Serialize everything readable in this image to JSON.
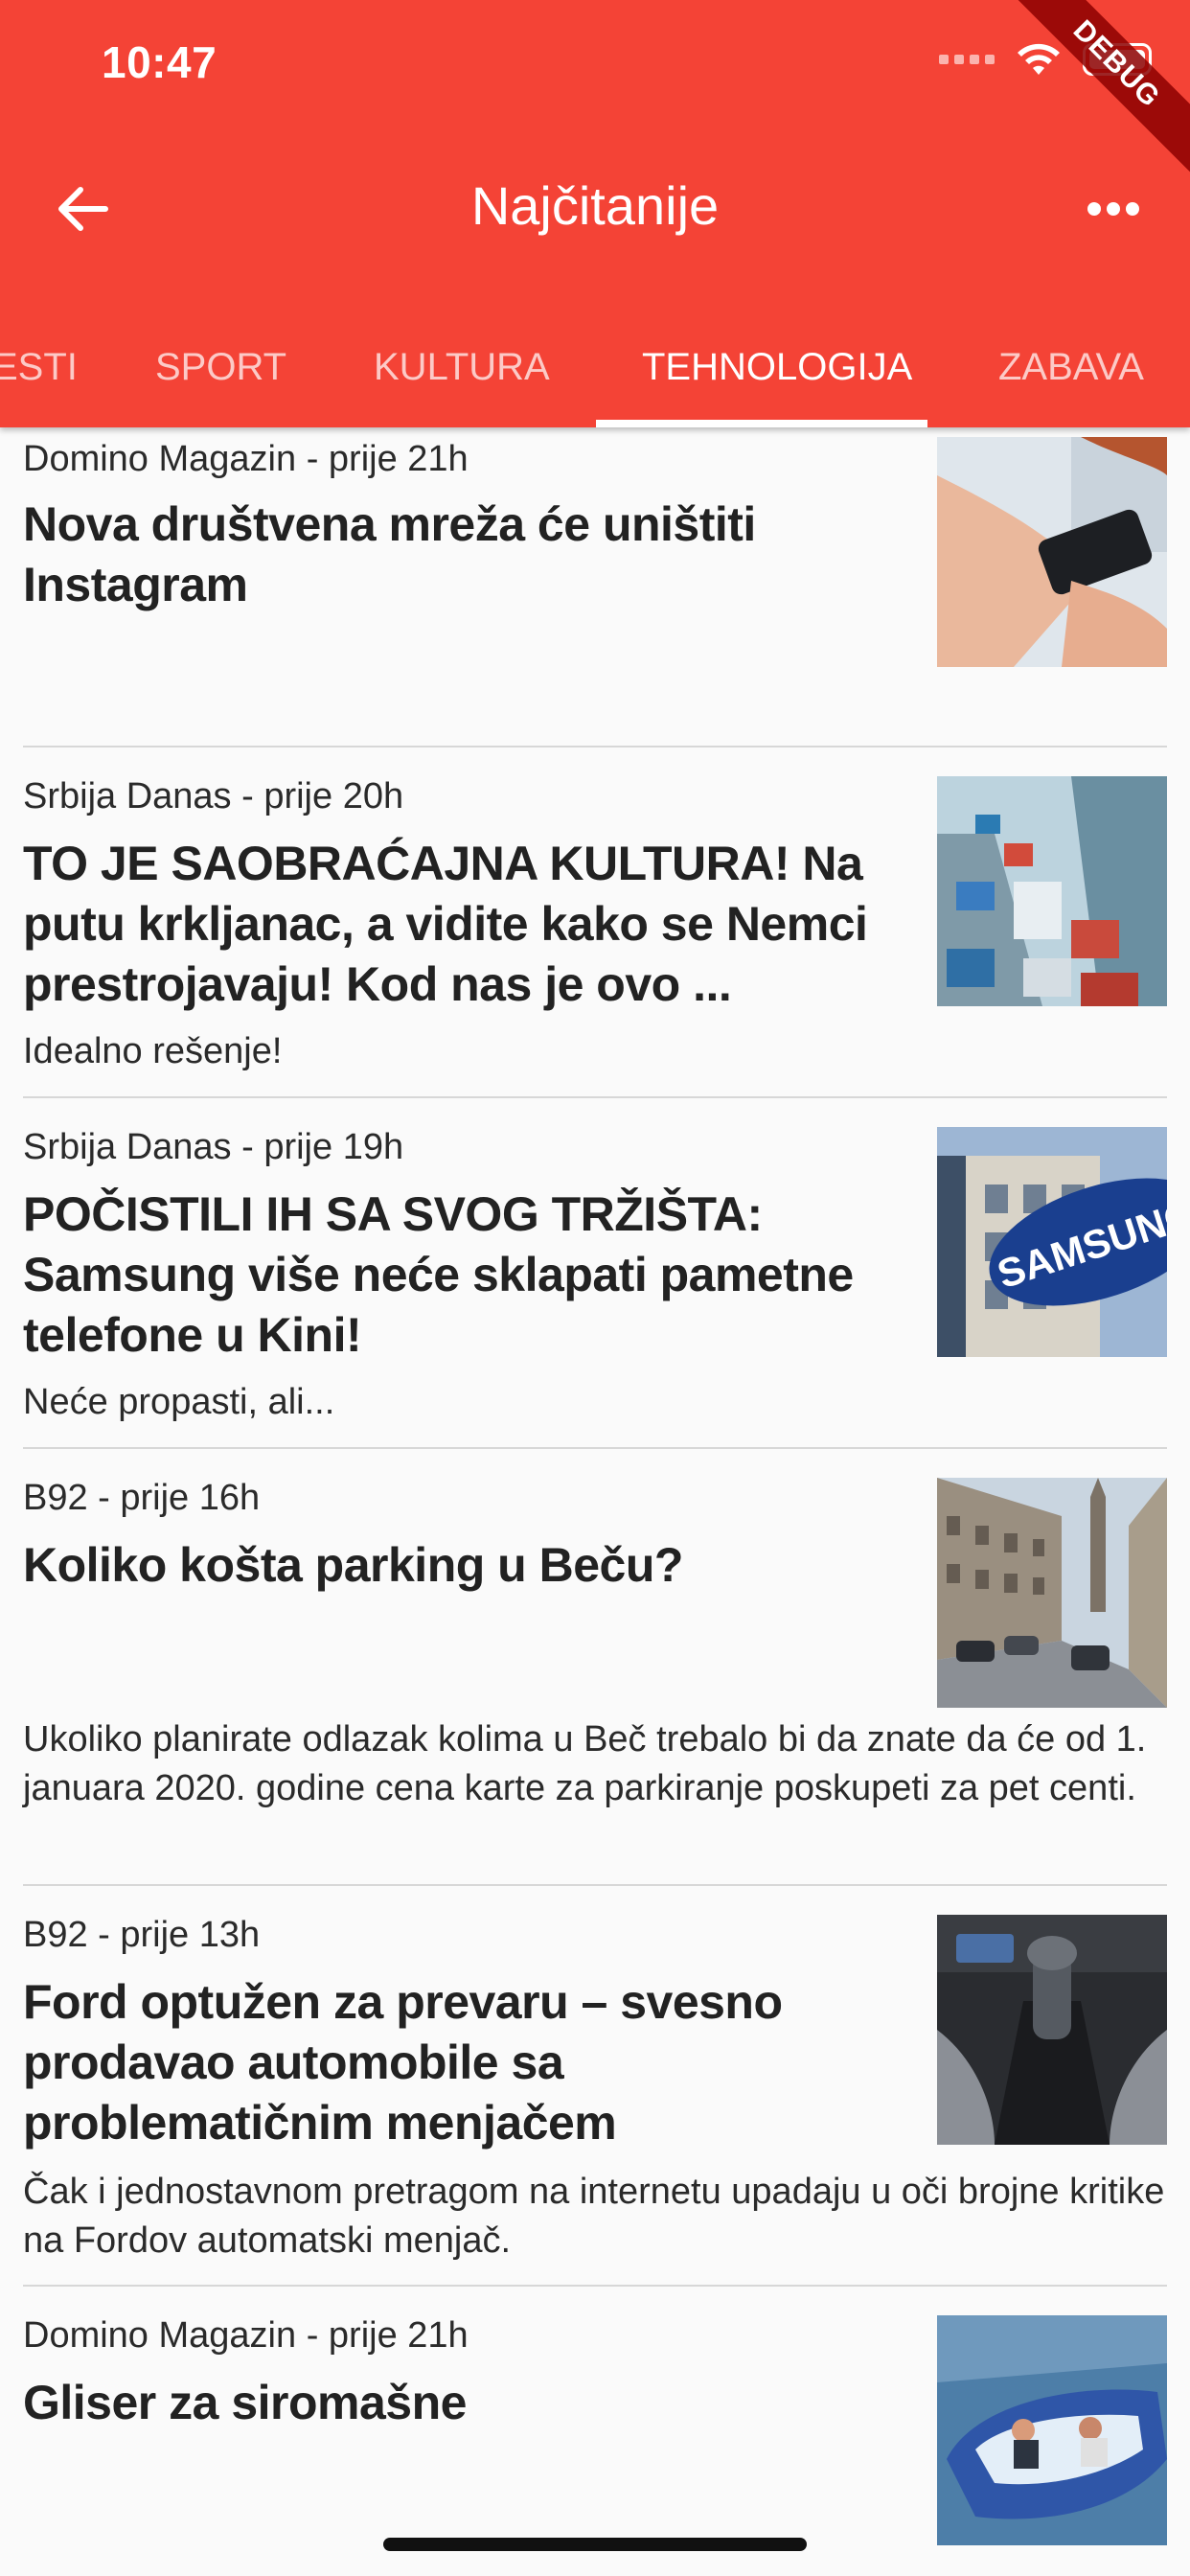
{
  "status": {
    "time": "10:47"
  },
  "debug_banner": "DEBUG",
  "appbar": {
    "title": "Najčitanije"
  },
  "tabs": [
    {
      "label": "ESTI"
    },
    {
      "label": "SPORT"
    },
    {
      "label": "KULTURA"
    },
    {
      "label": "TEHNOLOGIJA",
      "active": true
    },
    {
      "label": "ZABAVA"
    }
  ],
  "articles": [
    {
      "meta": "Domino Magazin - prije 21h",
      "title": "Nova društvena mreža će uništiti Instagram",
      "summary": "",
      "image": "phone-in-hands"
    },
    {
      "meta": "Srbija Danas - prije 20h",
      "title": "TO JE SAOBRAĆAJNA KULTURA! Na putu krkljanac, a vidite kako se Nemci prestrojavaju! Kod nas je ovo ...",
      "summary": "Idealno rešenje!",
      "image": "traffic-jam"
    },
    {
      "meta": "Srbija Danas - prije 19h",
      "title": "POČISTILI IH SA SVOG TRŽIŠTA: Samsung više neće sklapati pametne telefone u Kini!",
      "summary": "Neće propasti, ali...",
      "image": "samsung-sign"
    },
    {
      "meta": "B92 - prije 16h",
      "title": "Koliko košta parking u Beču?",
      "summary": "Ukoliko planirate odlazak kolima u Beč trebalo bi da znate da će od 1. januara 2020. godine cena karte za parkiranje poskupeti za pet centi.",
      "image": "vienna-street"
    },
    {
      "meta": "B92 - prije 13h",
      "title": "Ford optužen za prevaru – svesno prodavao automobile sa problematičnim menjačem",
      "summary": "Čak i jednostavnom pretragom na internetu upadaju u oči brojne kritike na Fordov automatski menjač.",
      "image": "gear-shifter"
    },
    {
      "meta": "Domino Magazin - prije 21h",
      "title": "Gliser za siromašne",
      "summary": "",
      "image": "inflatable-boat"
    }
  ],
  "colors": {
    "primary": "#f44336",
    "background": "#fafafa"
  }
}
